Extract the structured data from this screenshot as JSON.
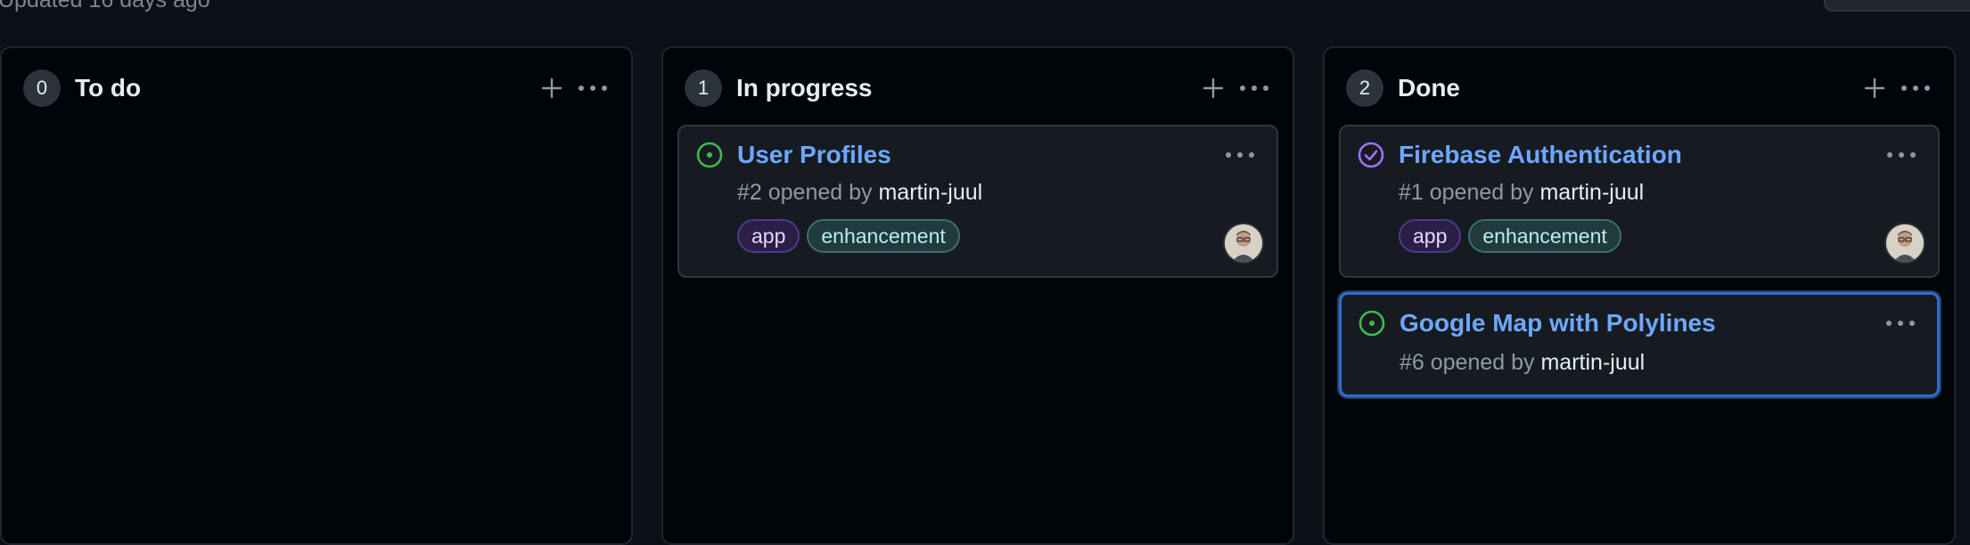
{
  "header": {
    "updated_text": "Updated 16 days ago"
  },
  "columns": [
    {
      "count": "0",
      "title": "To do",
      "cards": []
    },
    {
      "count": "1",
      "title": "In progress",
      "cards": [
        {
          "status": "open",
          "title": "User Profiles",
          "meta_prefix": "#2 opened by ",
          "author": "martin-juul",
          "labels": [
            "app",
            "enhancement"
          ],
          "has_avatar": true
        }
      ]
    },
    {
      "count": "2",
      "title": "Done",
      "cards": [
        {
          "status": "closed",
          "title": "Firebase Authentication",
          "meta_prefix": "#1 opened by ",
          "author": "martin-juul",
          "labels": [
            "app",
            "enhancement"
          ],
          "has_avatar": true
        },
        {
          "status": "open",
          "title": "Google Map with Polylines",
          "meta_prefix": "#6 opened by ",
          "author": "martin-juul",
          "labels": [],
          "has_avatar": false,
          "selected": true
        }
      ]
    }
  ],
  "colors": {
    "open_status": "#3fb950",
    "closed_status": "#a371f7",
    "link": "#6ea8ff",
    "selected_border": "#316dca"
  },
  "icons": {
    "add": "plus-icon",
    "more": "kebab-horizontal-icon",
    "open": "issue-opened-icon",
    "closed": "issue-closed-icon"
  }
}
